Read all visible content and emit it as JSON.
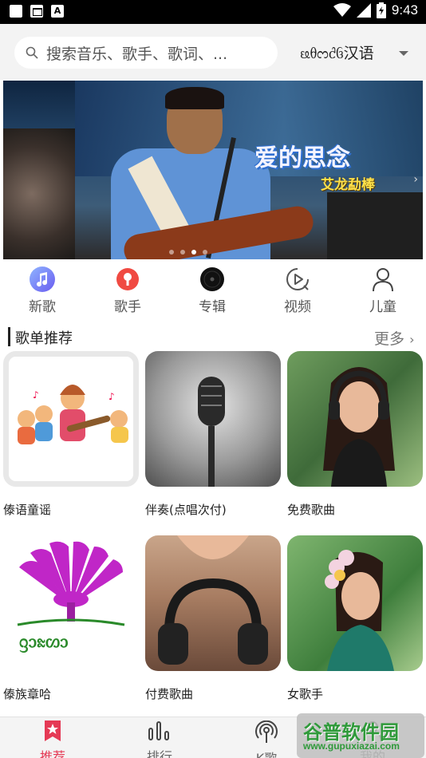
{
  "status_bar": {
    "time": "9:43"
  },
  "header": {
    "search_placeholder": "搜索音乐、歌手、歌词、...",
    "language_label": "ᦕᦲᦂᦺᦑ汉语"
  },
  "banner": {
    "title": "爱的思念",
    "subtitle": "艾龙勐棒",
    "slide_count": 4,
    "active_slide": 2
  },
  "categories": [
    {
      "label": "新歌",
      "icon": "music-note-icon"
    },
    {
      "label": "歌手",
      "icon": "singer-icon"
    },
    {
      "label": "专辑",
      "icon": "album-disc-icon"
    },
    {
      "label": "视频",
      "icon": "video-play-icon"
    },
    {
      "label": "儿童",
      "icon": "child-person-icon"
    }
  ],
  "playlist_section": {
    "title": "歌单推荐",
    "more_label": "更多",
    "items": [
      {
        "label": "傣语童谣"
      },
      {
        "label": "伴奏(点唱次付)"
      },
      {
        "label": "免费歌曲"
      },
      {
        "label": "傣族章哈"
      },
      {
        "label": "付费歌曲"
      },
      {
        "label": "女歌手"
      }
    ],
    "logo_text": "ᦋᦱᦰᦠᦱ 傣族章哈"
  },
  "bottom_nav": [
    {
      "label": "推荐",
      "active": true,
      "icon": "star-bookmark-icon"
    },
    {
      "label": "排行",
      "active": false,
      "icon": "bar-chart-icon"
    },
    {
      "label": "K歌",
      "active": false,
      "icon": "broadcast-icon"
    },
    {
      "label": "我的",
      "active": false,
      "icon": "user-icon"
    }
  ],
  "watermark": {
    "title": "谷普软件园",
    "url": "www.gupuxiazai.com"
  },
  "colors": {
    "accent": "#e53a55",
    "header_bg": "#f3f3f3"
  }
}
